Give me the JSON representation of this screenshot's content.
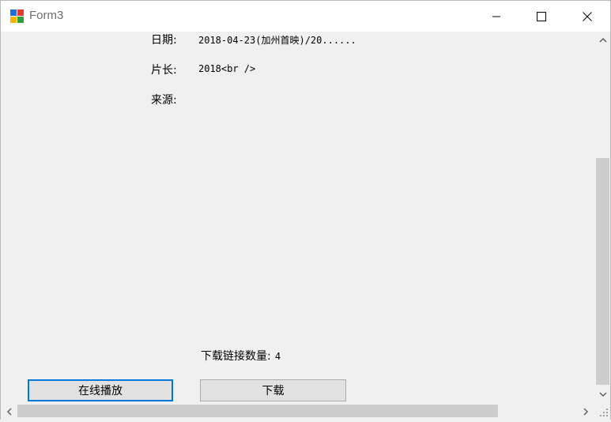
{
  "window": {
    "title": "Form3"
  },
  "fields": [
    {
      "label": "日期:",
      "value": "2018-04-23(加州首映)/20......"
    },
    {
      "label": "片长:",
      "value": "2018<br />"
    },
    {
      "label": "来源:",
      "value": ""
    }
  ],
  "download_count": {
    "label": "下载链接数量:",
    "value": "4"
  },
  "buttons": {
    "play_online": "在线播放",
    "download": "下载"
  },
  "colors": {
    "focus_border": "#0078d7",
    "button_bg": "#e1e1e1",
    "form_bg": "#f0f0f0"
  }
}
